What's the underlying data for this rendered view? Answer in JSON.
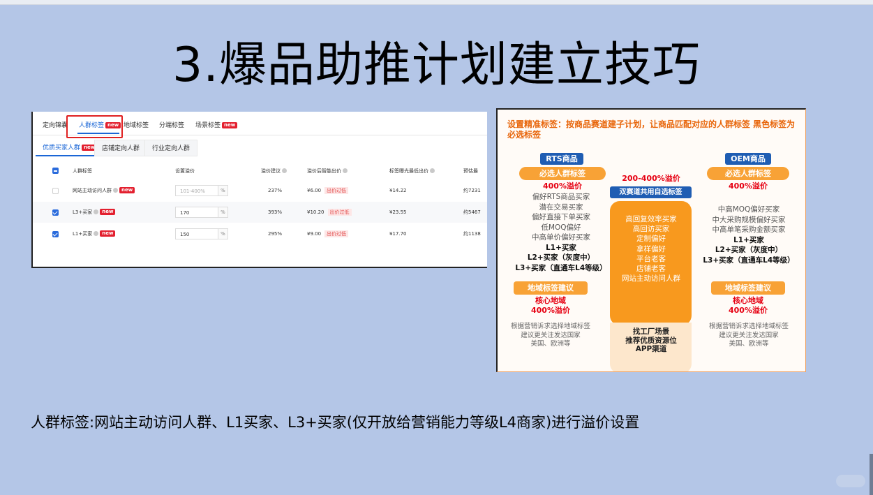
{
  "slide": {
    "title": "3.爆品助推计划建立技巧",
    "caption": "人群标签:网站主动访问人群、L1买家、L3+买家(仅开放给营销能力等级L4商家)进行溢价设置"
  },
  "panel": {
    "tabs": [
      {
        "label": "定向锦囊"
      },
      {
        "label": "人群标签",
        "badge": "new"
      },
      {
        "label": "地域标签"
      },
      {
        "label": "分端标签"
      },
      {
        "label": "场景标签",
        "badge": "new"
      }
    ],
    "subtabs": [
      {
        "label": "优质买家人群",
        "badge": "new"
      },
      {
        "label": "店铺定向人群"
      },
      {
        "label": "行业定向人群"
      }
    ],
    "columns": [
      "人群标签",
      "设置溢价",
      "溢价建议",
      "溢价后智能出价",
      "标签曝光最低出价",
      "预估最"
    ],
    "rows": [
      {
        "name": "网站主动访问人群",
        "badge": "new",
        "checked": false,
        "input": "",
        "placeholder": "101-400%",
        "unit": "%",
        "suggest": "237%",
        "bid": "¥6.00",
        "flag": "出价过低",
        "min": "¥14.22",
        "est": "约7231"
      },
      {
        "name": "L3+买家",
        "badge": "new",
        "checked": true,
        "input": "170",
        "placeholder": "",
        "unit": "%",
        "suggest": "393%",
        "bid": "¥10.20",
        "flag": "出价过低",
        "min": "¥23.55",
        "est": "约5467"
      },
      {
        "name": "L1+买家",
        "badge": "new",
        "checked": true,
        "input": "150",
        "placeholder": "",
        "unit": "%",
        "suggest": "295%",
        "bid": "¥9.00",
        "flag": "出价过低",
        "min": "¥17.70",
        "est": "约1138"
      }
    ]
  },
  "info": {
    "headline": "设置精准标签：按商品赛道建子计划，让商品匹配对应的人群标签 黑色标签为必选标签",
    "rts": {
      "title": "RTS商品",
      "pill": "必选人群标签",
      "rate": "400%溢价",
      "tags_gray": [
        "偏好RTS商品买家",
        "潜在交易买家",
        "偏好直接下单买家",
        "低MOQ偏好",
        "中高单价偏好买家"
      ],
      "tags_black": [
        "L1+买家",
        "L2+买家（灰度中）",
        "L3+买家（直通车L4等级）"
      ]
    },
    "oem": {
      "title": "OEM商品",
      "pill": "必选人群标签",
      "rate": "400%溢价",
      "tags_gray": [
        "中高MOQ偏好买家",
        "中大采购规模偏好买家",
        "中高单笔采购金额买家"
      ],
      "tags_black": [
        "L1+买家",
        "L2+买家（灰度中）",
        "L3+买家（直通车L4等级）"
      ]
    },
    "center": {
      "rate": "200-400%溢价",
      "title": "双赛道共用自选标签",
      "tags": [
        "高回复效率买家",
        "高回访买家",
        "定制偏好",
        "拿样偏好",
        "平台老客",
        "店铺老客",
        "网站主动访问人群"
      ],
      "foot": [
        "找工厂场景",
        "推荐优质资源位",
        "APP渠道"
      ]
    },
    "region_left": {
      "pill": "地域标签建议",
      "core": "核心地域",
      "rate": "400%溢价",
      "note": [
        "根据营销诉求选择地域标签",
        "建议更关注发达国家",
        "美国、欧洲等"
      ]
    },
    "region_right": {
      "pill": "地域标签建议",
      "core": "核心地域",
      "rate": "400%溢价",
      "note": [
        "根据营销诉求选择地域标签",
        "建议更关注发达国家",
        "美国、欧洲等"
      ]
    }
  }
}
